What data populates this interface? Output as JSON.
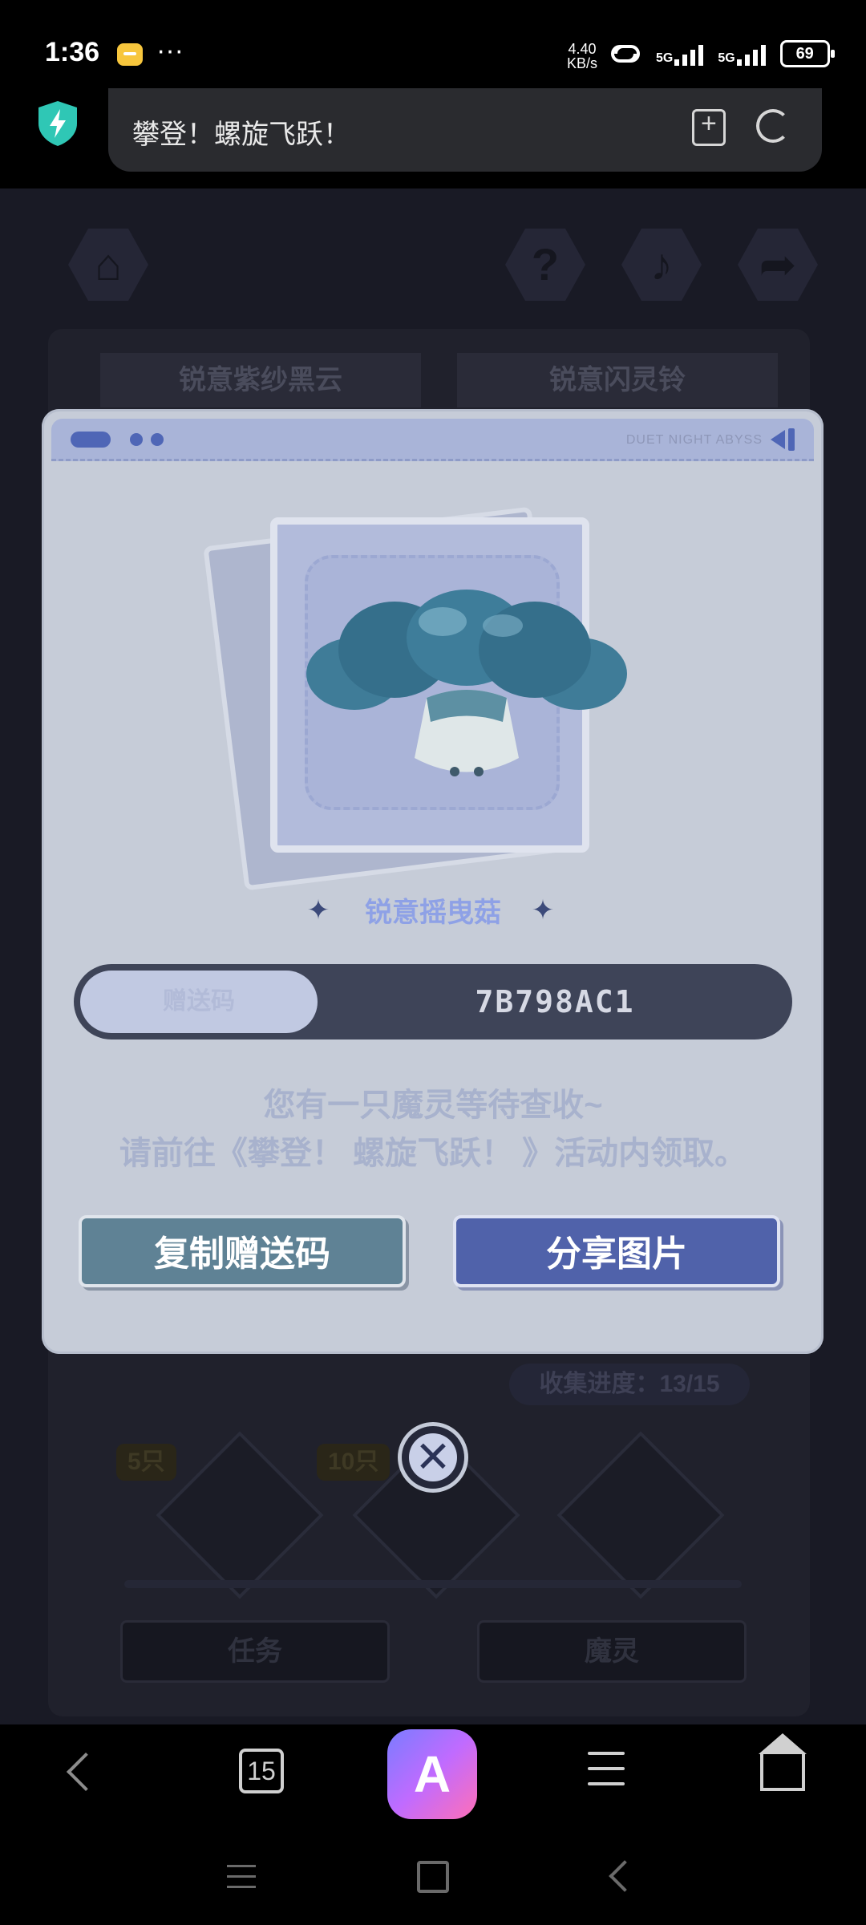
{
  "status_bar": {
    "time": "1:36",
    "dots": "···",
    "net_speed_value": "4.40",
    "net_speed_unit": "KB/s",
    "sim1": "5G",
    "sim2": "5G",
    "battery": "69"
  },
  "browser": {
    "title": "攀登！螺旋飞跃！"
  },
  "game_background": {
    "tab_left": "锐意紫纱黑云",
    "tab_right": "锐意闪灵铃",
    "progress_label": "收集进度：",
    "progress_value": "13/15",
    "milestone_1": "5只",
    "milestone_2": "10只",
    "btn_task": "任务",
    "btn_spirit": "魔灵"
  },
  "modal": {
    "brand": "DUET NIGHT ABYSS",
    "creature_name": "锐意摇曳菇",
    "code_label": "赠送码",
    "code_value": "7B798AC1",
    "notice_line1": "您有一只魔灵等待查收~",
    "notice_line2": "请前往《攀登！ 螺旋飞跃！ 》活动内领取。",
    "copy_button": "复制赠送码",
    "share_button": "分享图片"
  },
  "nav": {
    "tab_count": "15",
    "ai_label": "A"
  },
  "colors": {
    "modal_bg": "#c6ccd8",
    "accent_blue": "#5062aa",
    "copy_teal": "#5f8295"
  }
}
